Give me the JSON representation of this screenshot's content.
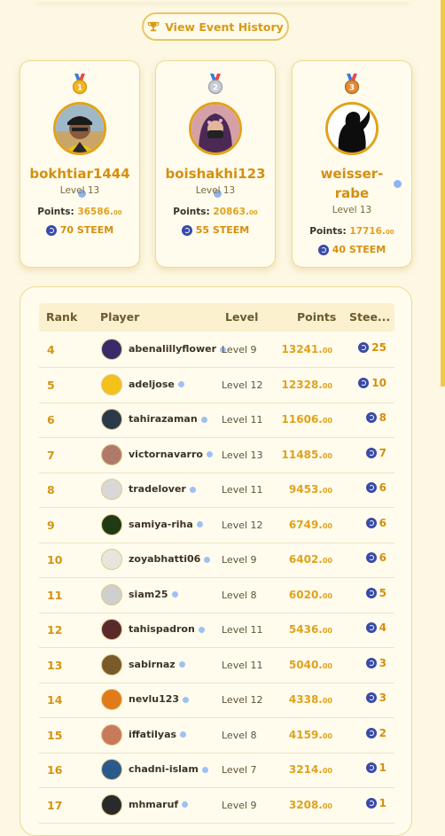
{
  "history_button": {
    "label": "View Event History"
  },
  "podium": [
    {
      "name": "bokhtiar1444",
      "level": "Level 13",
      "points_label": "Points:",
      "points": "36586.",
      "points_dec": "00",
      "steem": "70 STEEM",
      "medal": "gold-medal",
      "color": "#d58f0f"
    },
    {
      "name": "boishakhi123",
      "level": "Level 13",
      "points_label": "Points:",
      "points": "20863.",
      "points_dec": "00",
      "steem": "55 STEEM",
      "medal": "silver-medal",
      "color": "#d58f0f"
    },
    {
      "name": "weisser-rabe",
      "level": "Level 13",
      "points_label": "Points:",
      "points": "17716.",
      "points_dec": "00",
      "steem": "40 STEEM",
      "medal": "bronze-medal",
      "color": "#d58f0f"
    }
  ],
  "table": {
    "headers": {
      "rank": "Rank",
      "player": "Player",
      "level": "Level",
      "points": "Points",
      "steem": "Stee..."
    },
    "rows": [
      {
        "rank": "4",
        "player": "abenalillyflower",
        "level": "Level 9",
        "points": "13241.",
        "dec": "00",
        "steem": "25"
      },
      {
        "rank": "5",
        "player": "adeljose",
        "level": "Level 12",
        "points": "12328.",
        "dec": "00",
        "steem": "10"
      },
      {
        "rank": "6",
        "player": "tahirazaman",
        "level": "Level 11",
        "points": "11606.",
        "dec": "00",
        "steem": "8"
      },
      {
        "rank": "7",
        "player": "victornavarro",
        "level": "Level 13",
        "points": "11485.",
        "dec": "00",
        "steem": "7"
      },
      {
        "rank": "8",
        "player": "tradelover",
        "level": "Level 11",
        "points": "9453.",
        "dec": "00",
        "steem": "6"
      },
      {
        "rank": "9",
        "player": "samiya-riha",
        "level": "Level 12",
        "points": "6749.",
        "dec": "00",
        "steem": "6"
      },
      {
        "rank": "10",
        "player": "zoyabhatti06",
        "level": "Level 9",
        "points": "6402.",
        "dec": "00",
        "steem": "6"
      },
      {
        "rank": "11",
        "player": "siam25",
        "level": "Level 8",
        "points": "6020.",
        "dec": "00",
        "steem": "5"
      },
      {
        "rank": "12",
        "player": "tahispadron",
        "level": "Level 11",
        "points": "5436.",
        "dec": "00",
        "steem": "4"
      },
      {
        "rank": "13",
        "player": "sabirnaz",
        "level": "Level 11",
        "points": "5040.",
        "dec": "00",
        "steem": "3"
      },
      {
        "rank": "14",
        "player": "nevlu123",
        "level": "Level 12",
        "points": "4338.",
        "dec": "00",
        "steem": "3"
      },
      {
        "rank": "15",
        "player": "iffatilyas",
        "level": "Level 8",
        "points": "4159.",
        "dec": "00",
        "steem": "2"
      },
      {
        "rank": "16",
        "player": "chadni-islam",
        "level": "Level 7",
        "points": "3214.",
        "dec": "00",
        "steem": "1"
      },
      {
        "rank": "17",
        "player": "mhmaruf",
        "level": "Level 9",
        "points": "3208.",
        "dec": "00",
        "steem": "1"
      }
    ]
  }
}
